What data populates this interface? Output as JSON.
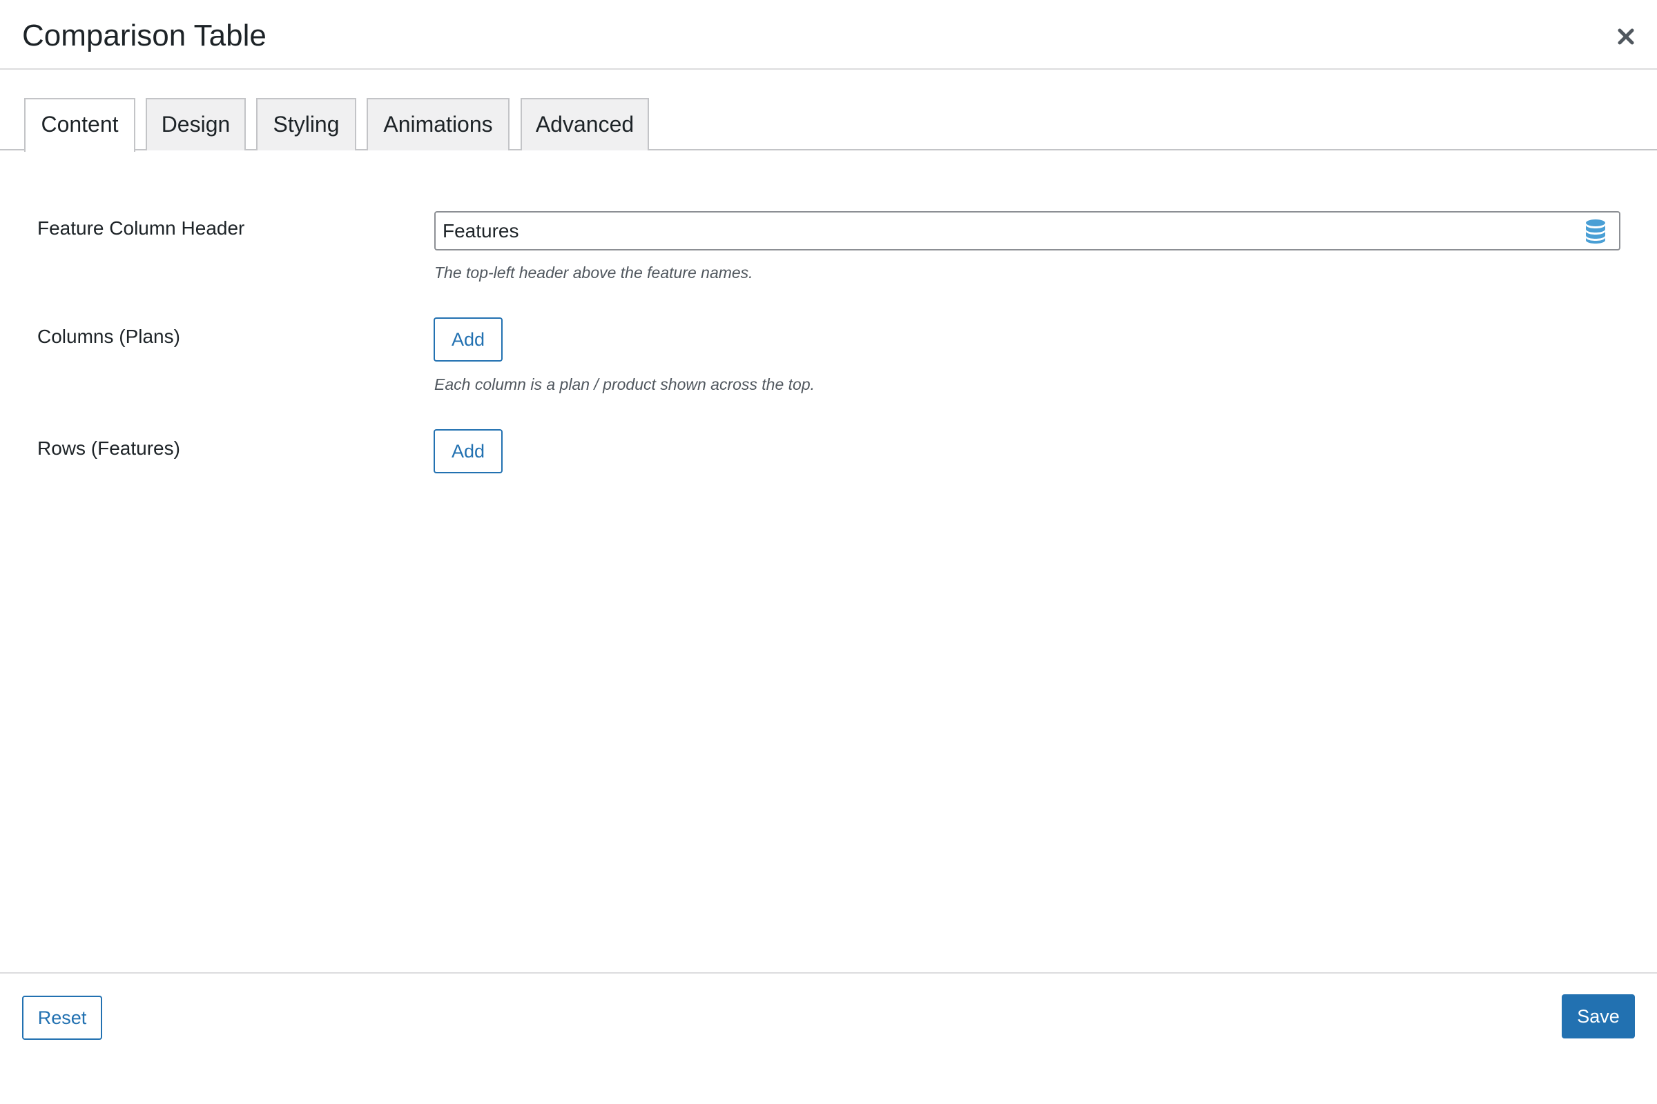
{
  "modal": {
    "title": "Comparison Table",
    "close_icon": "close-icon"
  },
  "tabs": [
    {
      "label": "Content",
      "active": true
    },
    {
      "label": "Design",
      "active": false
    },
    {
      "label": "Styling",
      "active": false
    },
    {
      "label": "Animations",
      "active": false
    },
    {
      "label": "Advanced",
      "active": false
    }
  ],
  "fields": {
    "feature_header": {
      "label": "Feature Column Header",
      "value": "Features",
      "description": "The top-left header above the feature names.",
      "icon": "database-icon"
    },
    "columns": {
      "label": "Columns (Plans)",
      "button_label": "Add",
      "description": "Each column is a plan / product shown across the top."
    },
    "rows": {
      "label": "Rows (Features)",
      "button_label": "Add"
    }
  },
  "footer": {
    "reset_label": "Reset",
    "save_label": "Save"
  },
  "colors": {
    "accent": "#2271b1",
    "icon_blue": "#4a9fd5",
    "border": "#c3c4c7",
    "tab_inactive_bg": "#f0f0f1"
  }
}
